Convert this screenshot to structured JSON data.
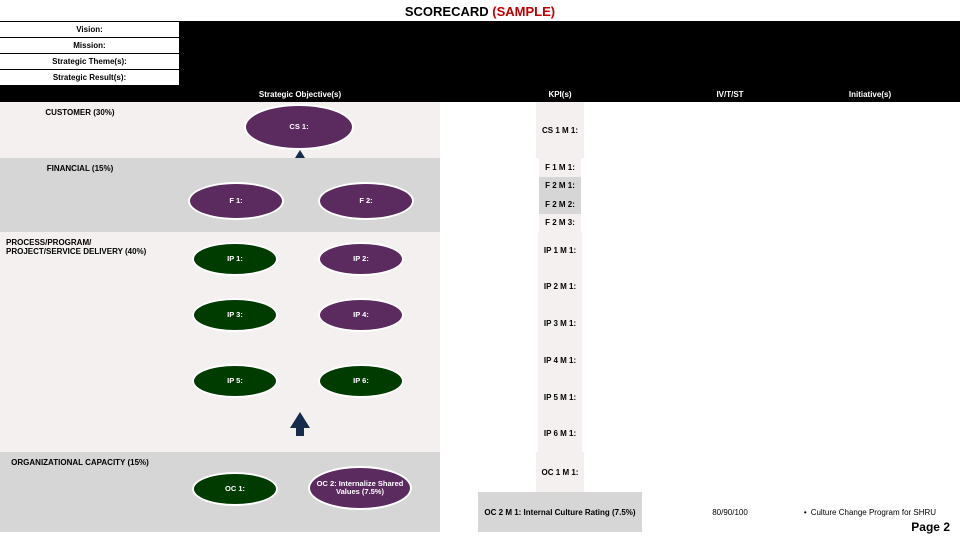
{
  "title_main": "SCORECARD",
  "title_suffix": "(SAMPLE)",
  "header": {
    "vision_label": "Vision:",
    "mission_label": "Mission:",
    "theme_label": "Strategic Theme(s):",
    "result_label": "Strategic Result(s):"
  },
  "columns": {
    "perspective": "",
    "objective": "Strategic Objective(s)",
    "kpi": "KPI(s)",
    "ivtst": "IV/T/ST",
    "initiative": "Initiative(s)"
  },
  "perspectives": {
    "customer": "CUSTOMER (30%)",
    "financial": "FINANCIAL (15%)",
    "process": "PROCESS/PROGRAM/ PROJECT/SERVICE DELIVERY (40%)",
    "orgcap": "ORGANIZATIONAL CAPACITY (15%)"
  },
  "bubbles": {
    "cs1": "CS 1:",
    "f1": "F 1:",
    "f2": "F 2:",
    "ip1": "IP 1:",
    "ip2": "IP 2:",
    "ip3": "IP 3:",
    "ip4": "IP 4:",
    "ip5": "IP 5:",
    "ip6": "IP 6:",
    "oc1": "OC 1:",
    "oc2": "OC 2: Internalize Shared Values (7.5%)"
  },
  "kpi": {
    "cs1m1": "CS 1 M 1:",
    "f1m1": "F 1 M 1:",
    "f2m1": "F 2 M 1:",
    "f2m2": "F 2 M 2:",
    "f2m3": "F 2 M 3:",
    "ip1m1": "IP 1 M 1:",
    "ip2m1": "IP 2 M 1:",
    "ip3m1": "IP 3 M 1:",
    "ip4m1": "IP 4 M 1:",
    "ip5m1": "IP 5 M 1:",
    "ip6m1": "IP 6 M 1:",
    "oc1m1": "OC 1 M 1:",
    "oc2m1": "OC 2 M 1: Internal Culture Rating (7.5%)"
  },
  "ivtst": {
    "oc2": "80/90/100"
  },
  "initiatives": {
    "oc2": "Culture Change Program for SHRU"
  },
  "footer": "Page 2"
}
